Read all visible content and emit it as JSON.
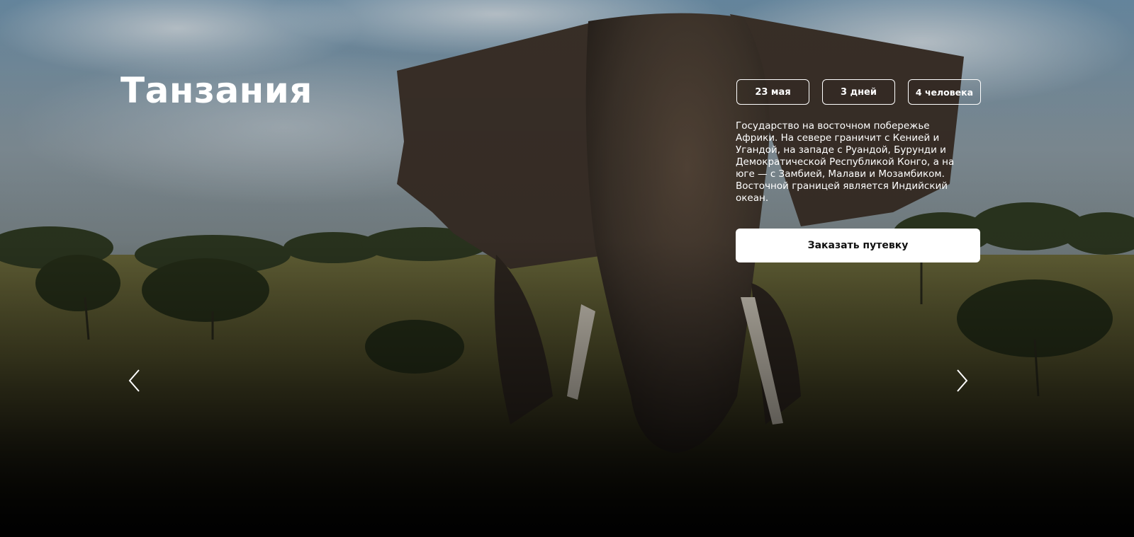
{
  "slide": {
    "title": "Танзания",
    "chips": {
      "date": "23 мая",
      "days": "3 дней",
      "people": "4 человека"
    },
    "description": "Государство на восточном побережье Африки. На севере граничит с Кенией и Угандой, на западе с Руандой, Бурунди и Демократической Республикой Конго, а на юге — с Замбией, Малави и Мозамбиком. Восточной границей является Индийский океан.",
    "book_button_label": "Заказать путевку"
  },
  "navigation": {
    "prev_icon": "chevron-left-icon",
    "next_icon": "chevron-right-icon"
  },
  "colors": {
    "text": "#ffffff",
    "button_bg": "#ffffff",
    "button_text": "#111111",
    "sky": "#7d97a8",
    "grass": "#6b6a3a",
    "elephant": "#4a3e34"
  }
}
